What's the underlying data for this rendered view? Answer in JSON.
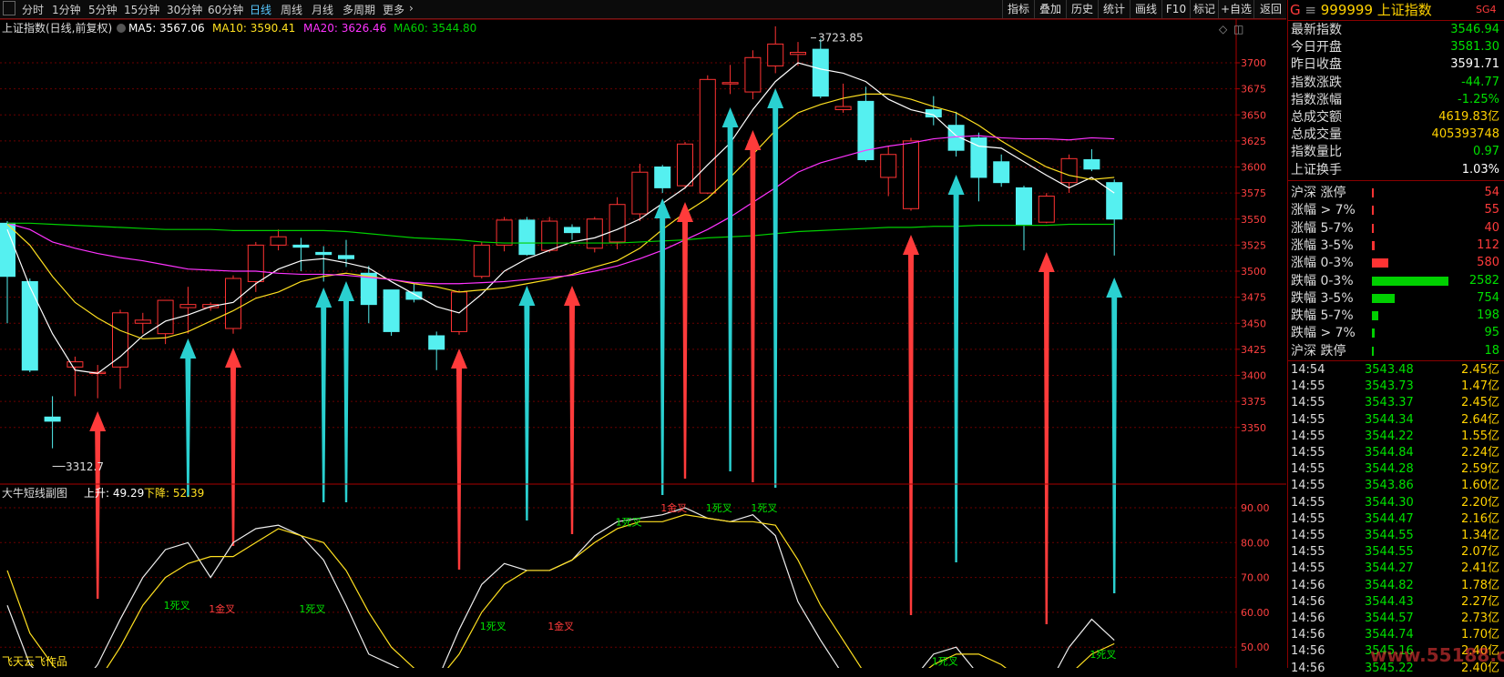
{
  "toolbar": {
    "tabs": [
      "分时",
      "1分钟",
      "5分钟",
      "15分钟",
      "30分钟",
      "日线",
      "周线",
      "月线",
      "多周期",
      "更多"
    ],
    "active": "日线",
    "right_buttons": [
      "指标",
      "叠加",
      "历史",
      "统计",
      "画线",
      "F10",
      "标记",
      "+自选",
      "返回"
    ]
  },
  "main_header": {
    "title": "上证指数(日线,前复权)",
    "ma5_label": "MA5: 3567.06",
    "ma10_label": "MA10: 3590.41",
    "ma20_label": "MA20: 3626.46",
    "ma60_label": "MA60: 3544.80"
  },
  "annotations": {
    "high_label": "3723.85",
    "low_label": "3312.7"
  },
  "sub_header": {
    "title": "大牛短线副图",
    "up_label": "上升: 49.29",
    "down_label": "下降: 52.39"
  },
  "cross_labels": [
    "死叉",
    "金叉",
    "死叉",
    "死叉",
    "金叉",
    "金叉",
    "死叉",
    "金叉",
    "死叉",
    "死叉",
    "金叉",
    "死叉",
    "金叉",
    "死叉"
  ],
  "colors": {
    "up": "#ff3333",
    "down": "#55f0f0",
    "ma5": "#ffffff",
    "ma10": "#ffe020",
    "ma20": "#ff33ff",
    "ma60": "#00d000",
    "arrow_red": "#ff3b3b",
    "arrow_cyan": "#2ad0d0",
    "grid": "#6a0000"
  },
  "chart_data": {
    "type": "candlestick",
    "y_ticks": [
      3350,
      3375,
      3400,
      3425,
      3450,
      3475,
      3500,
      3525,
      3550,
      3575,
      3600,
      3625,
      3650,
      3675,
      3700
    ],
    "sub_ticks": [
      40,
      50,
      60,
      70,
      80,
      90
    ],
    "candles": [
      [
        3546,
        3495,
        3548,
        3450
      ],
      [
        3490,
        3405,
        3493,
        3403
      ],
      [
        3360,
        3356,
        3380,
        3330
      ],
      [
        3408,
        3413,
        3418,
        3380
      ],
      [
        3403,
        3403,
        3410,
        3378
      ],
      [
        3408,
        3460,
        3463,
        3387
      ],
      [
        3450,
        3453,
        3460,
        3440
      ],
      [
        3440,
        3472,
        3472,
        3430
      ],
      [
        3465,
        3468,
        3485,
        3440
      ],
      [
        3465,
        3468,
        3470,
        3462
      ],
      [
        3445,
        3493,
        3496,
        3440
      ],
      [
        3490,
        3525,
        3528,
        3480
      ],
      [
        3525,
        3533,
        3540,
        3520
      ],
      [
        3525,
        3523,
        3532,
        3500
      ],
      [
        3518,
        3516,
        3524,
        3490
      ],
      [
        3515,
        3512,
        3530,
        3504
      ],
      [
        3498,
        3468,
        3505,
        3450
      ],
      [
        3482,
        3442,
        3482,
        3438
      ],
      [
        3480,
        3473,
        3488,
        3470
      ],
      [
        3438,
        3425,
        3442,
        3405
      ],
      [
        3442,
        3480,
        3482,
        3439
      ],
      [
        3495,
        3525,
        3528,
        3493
      ],
      [
        3525,
        3549,
        3552,
        3519
      ],
      [
        3549,
        3516,
        3552,
        3515
      ],
      [
        3520,
        3548,
        3552,
        3518
      ],
      [
        3542,
        3537,
        3545,
        3530
      ],
      [
        3522,
        3550,
        3552,
        3518
      ],
      [
        3528,
        3564,
        3571,
        3521
      ],
      [
        3555,
        3595,
        3603,
        3548
      ],
      [
        3600,
        3580,
        3602,
        3575
      ],
      [
        3582,
        3622,
        3624,
        3579
      ],
      [
        3575,
        3684,
        3688,
        3574
      ],
      [
        3680,
        3681,
        3698,
        3670
      ],
      [
        3672,
        3705,
        3712,
        3665
      ],
      [
        3697,
        3718,
        3735,
        3690
      ],
      [
        3708,
        3710,
        3720,
        3697
      ],
      [
        3713,
        3668,
        3723,
        3666
      ],
      [
        3655,
        3658,
        3680,
        3652
      ],
      [
        3663,
        3607,
        3677,
        3605
      ],
      [
        3590,
        3612,
        3620,
        3572
      ],
      [
        3560,
        3625,
        3628,
        3558
      ],
      [
        3655,
        3648,
        3668,
        3640
      ],
      [
        3640,
        3616,
        3653,
        3610
      ],
      [
        3628,
        3590,
        3633,
        3567
      ],
      [
        3605,
        3585,
        3612,
        3581
      ],
      [
        3580,
        3545,
        3582,
        3520
      ],
      [
        3547,
        3572,
        3575,
        3546
      ],
      [
        3585,
        3608,
        3612,
        3575
      ],
      [
        3607,
        3598,
        3617,
        3596
      ],
      [
        3585,
        3550,
        3588,
        3515
      ]
    ],
    "ma5": [
      3540,
      3485,
      3440,
      3405,
      3402,
      3418,
      3438,
      3452,
      3458,
      3466,
      3470,
      3488,
      3502,
      3510,
      3512,
      3508,
      3503,
      3490,
      3478,
      3466,
      3460,
      3478,
      3500,
      3512,
      3520,
      3528,
      3532,
      3540,
      3550,
      3565,
      3580,
      3602,
      3623,
      3655,
      3682,
      3700,
      3694,
      3690,
      3682,
      3665,
      3655,
      3650,
      3630,
      3620,
      3618,
      3605,
      3592,
      3580,
      3590,
      3575
    ],
    "ma10": [
      3545,
      3525,
      3495,
      3470,
      3455,
      3443,
      3435,
      3436,
      3442,
      3452,
      3462,
      3474,
      3480,
      3490,
      3495,
      3498,
      3495,
      3492,
      3488,
      3485,
      3480,
      3482,
      3484,
      3488,
      3492,
      3497,
      3504,
      3510,
      3522,
      3540,
      3556,
      3570,
      3590,
      3612,
      3635,
      3652,
      3660,
      3666,
      3670,
      3670,
      3665,
      3658,
      3652,
      3640,
      3625,
      3612,
      3600,
      3592,
      3588,
      3590
    ],
    "ma20": [
      3546,
      3540,
      3528,
      3522,
      3517,
      3513,
      3510,
      3506,
      3502,
      3501,
      3500,
      3500,
      3498,
      3497,
      3497,
      3496,
      3494,
      3492,
      3489,
      3488,
      3488,
      3489,
      3490,
      3492,
      3494,
      3496,
      3500,
      3505,
      3512,
      3520,
      3530,
      3540,
      3552,
      3566,
      3580,
      3595,
      3604,
      3610,
      3616,
      3620,
      3623,
      3627,
      3629,
      3630,
      3628,
      3627,
      3627,
      3626,
      3628,
      3627
    ],
    "ma60": [
      3546,
      3546,
      3545,
      3544,
      3543,
      3542,
      3541,
      3540,
      3540,
      3540,
      3539,
      3539,
      3539,
      3539,
      3539,
      3538,
      3536,
      3534,
      3532,
      3531,
      3530,
      3528,
      3527,
      3527,
      3527,
      3527,
      3527,
      3527,
      3528,
      3529,
      3530,
      3532,
      3533,
      3534,
      3536,
      3538,
      3539,
      3540,
      3541,
      3542,
      3542,
      3543,
      3543,
      3544,
      3544,
      3544,
      3544,
      3545,
      3545,
      3545
    ],
    "sub_white": [
      62,
      45,
      38,
      37,
      45,
      58,
      70,
      78,
      80,
      70,
      80,
      84,
      85,
      82,
      75,
      62,
      48,
      45,
      42,
      40,
      55,
      68,
      74,
      72,
      72,
      75,
      82,
      86,
      87,
      88,
      90,
      87,
      86,
      88,
      82,
      63,
      52,
      42,
      36,
      36,
      40,
      48,
      50,
      42,
      40,
      36,
      38,
      50,
      58,
      52
    ],
    "sub_yellow": [
      72,
      54,
      45,
      38,
      40,
      50,
      62,
      70,
      74,
      76,
      76,
      80,
      84,
      82,
      80,
      72,
      60,
      50,
      44,
      40,
      48,
      60,
      68,
      72,
      72,
      75,
      80,
      84,
      86,
      86,
      88,
      87,
      86,
      86,
      85,
      75,
      62,
      52,
      42,
      40,
      40,
      45,
      48,
      48,
      45,
      40,
      38,
      42,
      48,
      51
    ]
  },
  "info_panel": {
    "code": "999999",
    "name": "上证指数",
    "tag": "SG4",
    "rows": [
      {
        "label": "最新指数",
        "value": "3546.94",
        "color": "green"
      },
      {
        "label": "今日开盘",
        "value": "3581.30",
        "color": "green"
      },
      {
        "label": "昨日收盘",
        "value": "3591.71",
        "color": "white"
      },
      {
        "label": "指数涨跌",
        "value": "-44.77",
        "color": "green"
      },
      {
        "label": "指数涨幅",
        "value": "-1.25%",
        "color": "green"
      },
      {
        "label": "总成交额",
        "value": "4619.83亿",
        "color": "yellow"
      },
      {
        "label": "总成交量",
        "value": "405393748",
        "color": "yellow"
      },
      {
        "label": "指数量比",
        "value": "0.97",
        "color": "green"
      },
      {
        "label": "上证换手",
        "value": "1.03%",
        "color": "white"
      }
    ],
    "breadth": [
      {
        "label": "沪深 涨停",
        "value": "54",
        "color": "red",
        "level": 0.01
      },
      {
        "label": "涨幅 > 7%",
        "value": "55",
        "color": "red",
        "level": 0.01
      },
      {
        "label": "涨幅 5-7%",
        "value": "40",
        "color": "red",
        "level": 0.01
      },
      {
        "label": "涨幅 3-5%",
        "value": "112",
        "color": "red",
        "level": 0.04
      },
      {
        "label": "涨幅 0-3%",
        "value": "580",
        "color": "red",
        "level": 0.22
      },
      {
        "label": "跌幅 0-3%",
        "value": "2582",
        "color": "green",
        "level": 1.0
      },
      {
        "label": "跌幅 3-5%",
        "value": "754",
        "color": "green",
        "level": 0.3
      },
      {
        "label": "跌幅 5-7%",
        "value": "198",
        "color": "green",
        "level": 0.08
      },
      {
        "label": "跌幅 > 7%",
        "value": "95",
        "color": "green",
        "level": 0.04
      },
      {
        "label": "沪深 跌停",
        "value": "18",
        "color": "green",
        "level": 0.01
      }
    ],
    "ticks": [
      {
        "time": "14:54",
        "price": "3543.48",
        "amount": "2.45亿"
      },
      {
        "time": "14:55",
        "price": "3543.73",
        "amount": "1.47亿"
      },
      {
        "time": "14:55",
        "price": "3543.37",
        "amount": "2.45亿"
      },
      {
        "time": "14:55",
        "price": "3544.34",
        "amount": "2.64亿"
      },
      {
        "time": "14:55",
        "price": "3544.22",
        "amount": "1.55亿"
      },
      {
        "time": "14:55",
        "price": "3544.84",
        "amount": "2.24亿"
      },
      {
        "time": "14:55",
        "price": "3544.28",
        "amount": "2.59亿"
      },
      {
        "time": "14:55",
        "price": "3543.86",
        "amount": "1.60亿"
      },
      {
        "time": "14:55",
        "price": "3544.30",
        "amount": "2.20亿"
      },
      {
        "time": "14:55",
        "price": "3544.47",
        "amount": "2.16亿"
      },
      {
        "time": "14:55",
        "price": "3544.55",
        "amount": "1.34亿"
      },
      {
        "time": "14:55",
        "price": "3544.55",
        "amount": "2.07亿"
      },
      {
        "time": "14:55",
        "price": "3544.27",
        "amount": "2.41亿"
      },
      {
        "time": "14:56",
        "price": "3544.82",
        "amount": "1.78亿"
      },
      {
        "time": "14:56",
        "price": "3544.43",
        "amount": "2.27亿"
      },
      {
        "time": "14:56",
        "price": "3544.57",
        "amount": "2.73亿"
      },
      {
        "time": "14:56",
        "price": "3544.74",
        "amount": "1.70亿"
      },
      {
        "time": "14:56",
        "price": "3545.16",
        "amount": "2.40亿"
      },
      {
        "time": "14:56",
        "price": "3545.22",
        "amount": "2.40亿"
      }
    ]
  },
  "watermark": "www.55188.com",
  "author_text": "飞天云飞作品"
}
